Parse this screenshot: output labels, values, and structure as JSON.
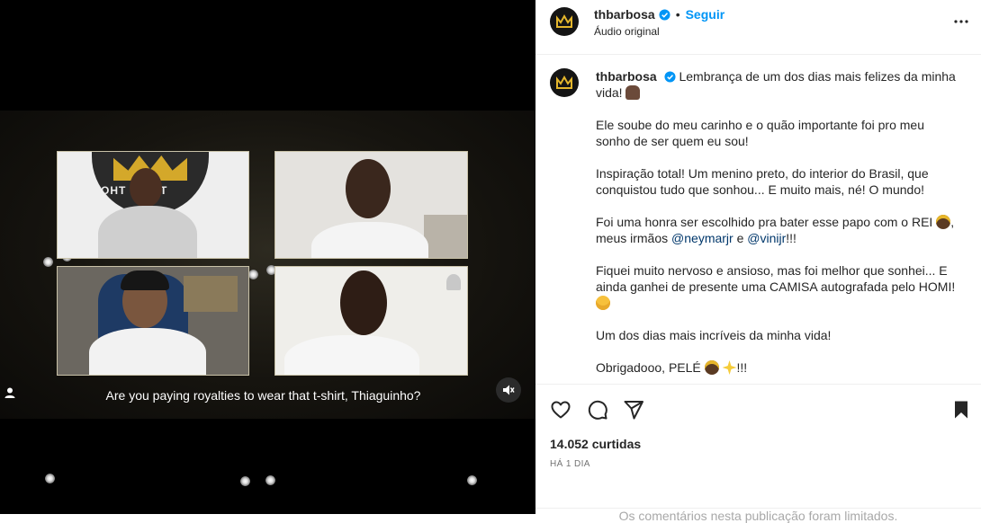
{
  "video": {
    "caption": "Are you paying royalties to wear that t-shirt, Thiaguinho?",
    "studio_sign": "OHT  ƆIAHT",
    "user_icon": "user-icon",
    "mute_icon": "speaker-muted-icon"
  },
  "header": {
    "username": "thbarbosa",
    "separator": "•",
    "follow_label": "Seguir",
    "audio_label": "Áudio original",
    "verified_icon": "verified-badge-icon",
    "more_icon": "more-options-icon"
  },
  "caption": {
    "username": "thbarbosa",
    "line1": "Lembrança de um dos dias mais felizes da minha vida!",
    "para2": "Ele soube do meu carinho e o quão importante foi pro meu sonho de ser quem eu sou!",
    "para3": "Inspiração total! Um menino preto, do interior do Brasil, que conquistou tudo que sonhou... E muito mais, né! O mundo!",
    "para4_a": "Foi uma honra ser escolhido pra bater esse papo com o REI",
    "para4_b": ", meus irmãos",
    "mention1": "@neymarjr",
    "para4_c": "e",
    "mention2": "@vinijr",
    "para4_d": "!!!",
    "para5": "Fiquei muito nervoso e ansioso, mas foi melhor que sonhei... E ainda ganhei de presente uma CAMISA autografada pelo HOMI!",
    "para6": "Um dos dias mais incríveis da minha vida!",
    "para7_a": "Obrigadooo, PELÉ",
    "para7_b": "!!!"
  },
  "actions": {
    "like_icon": "heart-icon",
    "comment_icon": "comment-icon",
    "share_icon": "send-icon",
    "save_icon": "bookmark-icon",
    "likes": "14.052 curtidas",
    "date": "HÁ 1 DIA",
    "comments_note": "Os comentários nesta publicação foram limitados."
  },
  "colors": {
    "link": "#0095f6",
    "mention": "#00376b",
    "verified": "#0095f6"
  }
}
